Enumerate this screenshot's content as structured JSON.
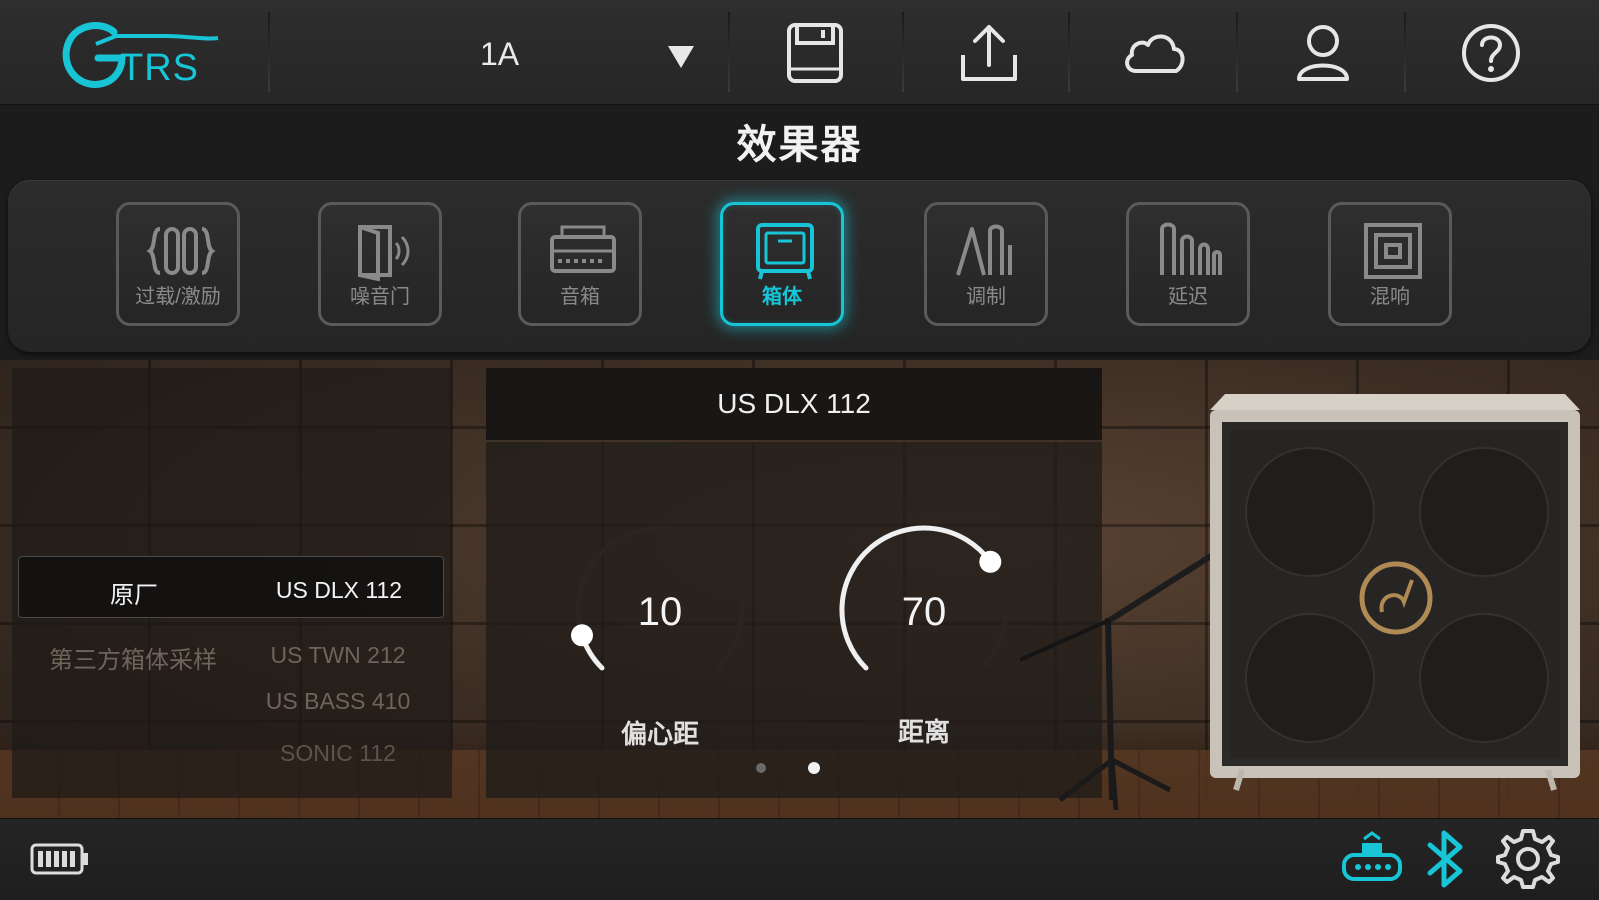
{
  "app": {
    "logo_text": "GTRS",
    "accent_color": "#17c5d6"
  },
  "topbar": {
    "preset": "1A",
    "icons": [
      "chevron-down-icon",
      "save-icon",
      "upload-icon",
      "cloud-icon",
      "user-icon",
      "help-icon"
    ]
  },
  "page": {
    "title": "效果器"
  },
  "modules": [
    {
      "label": "过载/激励",
      "icon": "overdrive-icon",
      "active": false
    },
    {
      "label": "噪音门",
      "icon": "noise-gate-icon",
      "active": false
    },
    {
      "label": "音箱",
      "icon": "amp-icon",
      "active": false
    },
    {
      "label": "箱体",
      "icon": "cabinet-icon",
      "active": true
    },
    {
      "label": "调制",
      "icon": "modulation-icon",
      "active": false
    },
    {
      "label": "延迟",
      "icon": "delay-icon",
      "active": false
    },
    {
      "label": "混响",
      "icon": "reverb-icon",
      "active": false
    }
  ],
  "cab_list": {
    "rows": [
      {
        "category": "原厂",
        "model": "US DLX 112",
        "selected": true
      },
      {
        "category": "第三方箱体采样",
        "model": "US TWN 212",
        "selected": false
      },
      {
        "category": "",
        "model": "US BASS 410",
        "selected": false
      },
      {
        "category": "",
        "model": "SONIC 112",
        "selected": false
      }
    ]
  },
  "cab_panel": {
    "title": "US DLX 112",
    "knobs": [
      {
        "label": "偏心距",
        "value": "10",
        "level": 0.1
      },
      {
        "label": "距离",
        "value": "70",
        "level": 0.7
      }
    ],
    "pages": 2,
    "current_page": 2
  },
  "bottombar": {
    "icons": [
      "battery-icon",
      "device-connection-icon",
      "bluetooth-icon",
      "settings-icon"
    ]
  }
}
